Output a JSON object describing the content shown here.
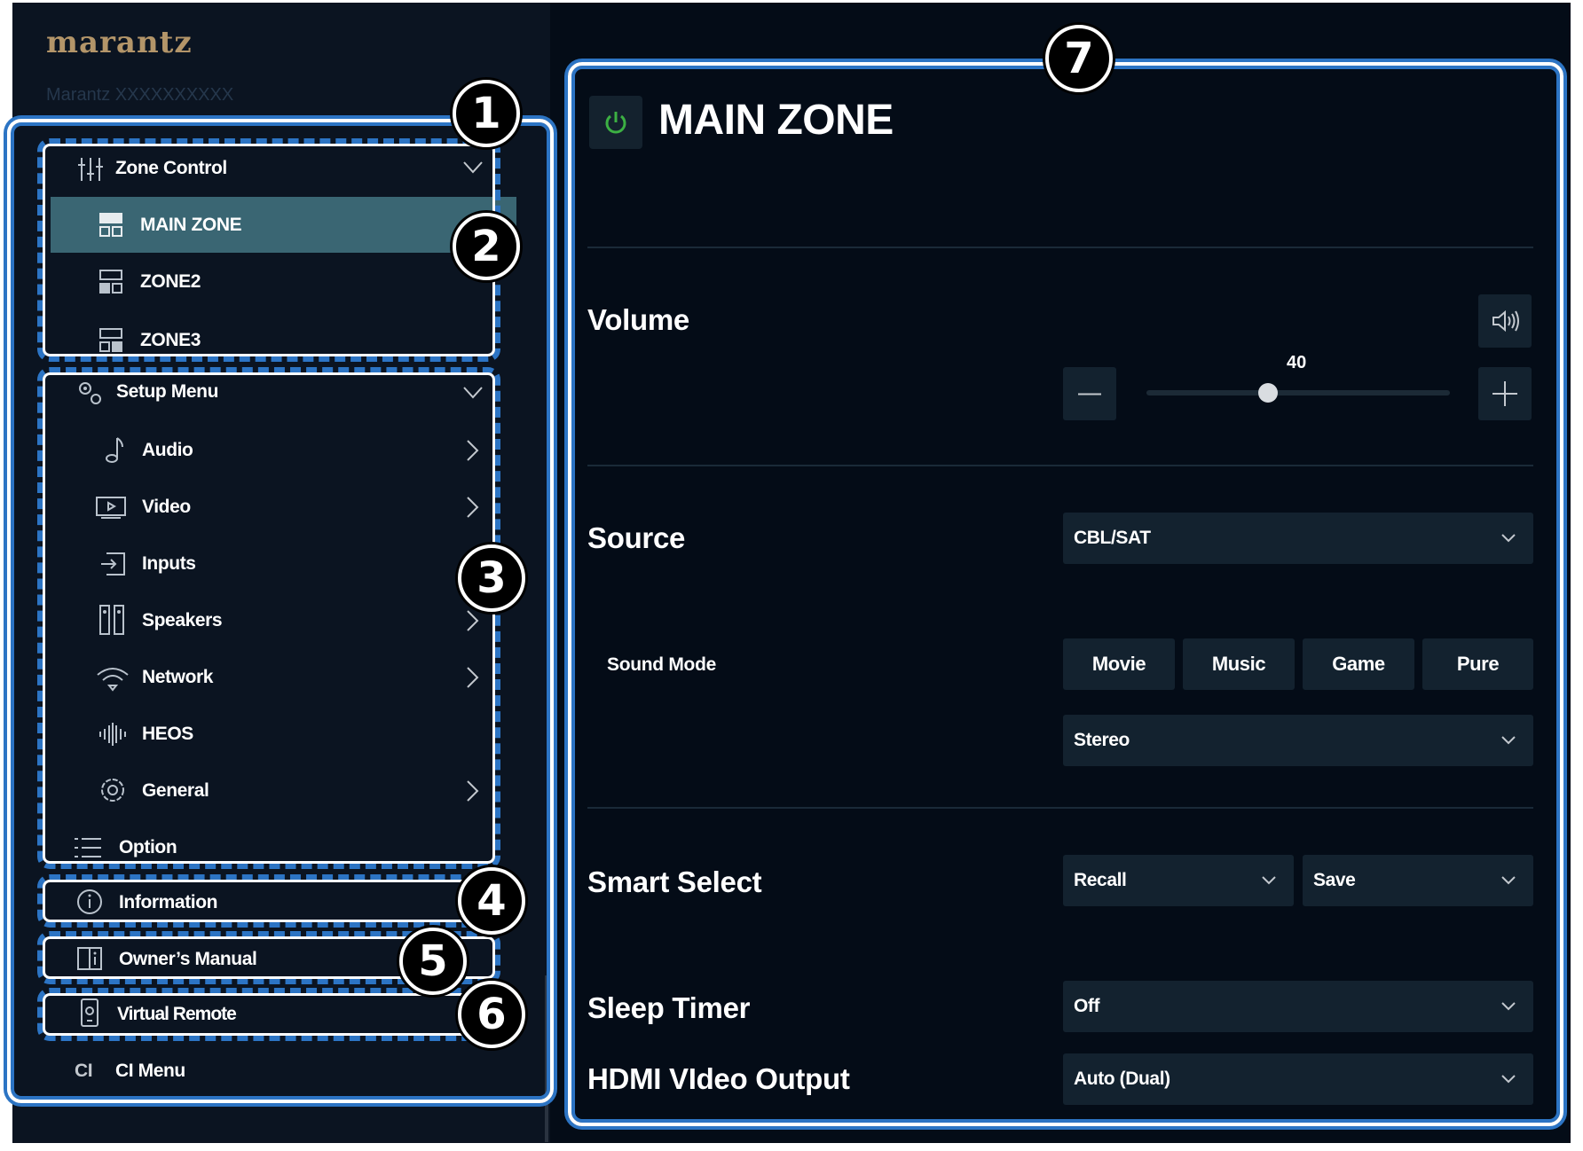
{
  "app": {
    "brand": "marantz",
    "model_name": "Marantz XXXXXXXXXX"
  },
  "sidebar": {
    "zone_control": {
      "label": "Zone Control",
      "zones": [
        {
          "label": "MAIN ZONE",
          "selected": true
        },
        {
          "label": "ZONE2",
          "selected": false
        },
        {
          "label": "ZONE3",
          "selected": false
        }
      ]
    },
    "setup_menu": {
      "label": "Setup Menu",
      "items": [
        {
          "label": "Audio",
          "icon": "music-note-icon"
        },
        {
          "label": "Video",
          "icon": "tv-icon"
        },
        {
          "label": "Inputs",
          "icon": "input-icon"
        },
        {
          "label": "Speakers",
          "icon": "speakers-icon"
        },
        {
          "label": "Network",
          "icon": "wifi-icon"
        },
        {
          "label": "HEOS",
          "icon": "heos-icon"
        },
        {
          "label": "General",
          "icon": "gear-icon"
        }
      ]
    },
    "option": {
      "label": "Option"
    },
    "information": {
      "label": "Information"
    },
    "owners_manual": {
      "label": "Owner’s Manual"
    },
    "virtual_remote": {
      "label": "Virtual Remote"
    },
    "ci_menu": {
      "icon_text": "CI",
      "label": "CI Menu"
    }
  },
  "main": {
    "zone_title": "MAIN ZONE",
    "volume": {
      "label": "Volume",
      "value": "40",
      "level_fraction": 0.4
    },
    "source": {
      "label": "Source",
      "selected": "CBL/SAT"
    },
    "sound_mode": {
      "label": "Sound Mode",
      "buttons": [
        "Movie",
        "Music",
        "Game",
        "Pure"
      ],
      "selected": "Stereo"
    },
    "smart_select": {
      "label": "Smart Select",
      "recall": "Recall",
      "save": "Save"
    },
    "sleep_timer": {
      "label": "Sleep Timer",
      "selected": "Off"
    },
    "hdmi_output": {
      "label": "HDMI VIdeo Output",
      "selected": "Auto (Dual)"
    }
  },
  "callouts": [
    "1",
    "2",
    "3",
    "4",
    "5",
    "6",
    "7"
  ],
  "colors": {
    "accent_blue": "#2c74c4",
    "selected_bg": "#3a6673",
    "brand_gold": "#b39569",
    "power_green": "#3cb043"
  }
}
